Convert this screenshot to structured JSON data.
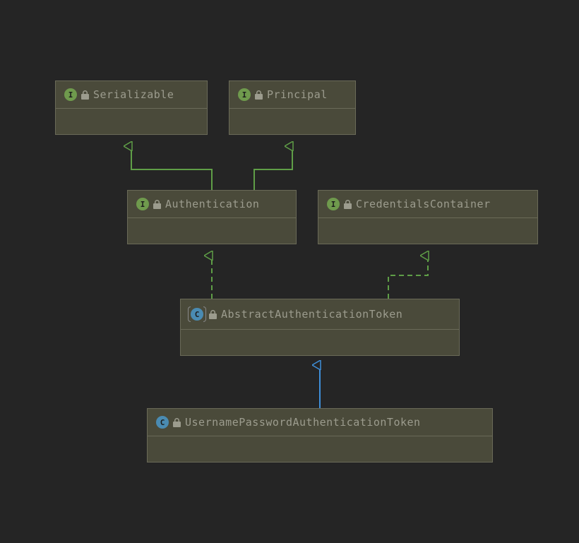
{
  "nodes": {
    "serializable": {
      "label": "Serializable",
      "type": "I"
    },
    "principal": {
      "label": "Principal",
      "type": "I"
    },
    "authentication": {
      "label": "Authentication",
      "type": "I"
    },
    "credentialsContainer": {
      "label": "CredentialsContainer",
      "type": "I"
    },
    "abstractAuthenticationToken": {
      "label": "AbstractAuthenticationToken",
      "type": "C",
      "abstract": true
    },
    "usernamePasswordAuthenticationToken": {
      "label": "UsernamePasswordAuthenticationToken",
      "type": "C"
    }
  },
  "edges": [
    {
      "from": "authentication",
      "to": "serializable",
      "style": "solid",
      "color": "green"
    },
    {
      "from": "authentication",
      "to": "principal",
      "style": "solid",
      "color": "green"
    },
    {
      "from": "abstractAuthenticationToken",
      "to": "authentication",
      "style": "dashed",
      "color": "green"
    },
    {
      "from": "abstractAuthenticationToken",
      "to": "credentialsContainer",
      "style": "dashed",
      "color": "green"
    },
    {
      "from": "usernamePasswordAuthenticationToken",
      "to": "abstractAuthenticationToken",
      "style": "solid",
      "color": "blue"
    }
  ],
  "colors": {
    "green": "#5f9e47",
    "blue": "#3f8fd9",
    "nodeBg": "#4a4a3a",
    "nodeBorder": "#6a6a58",
    "canvasBg": "#252525"
  }
}
